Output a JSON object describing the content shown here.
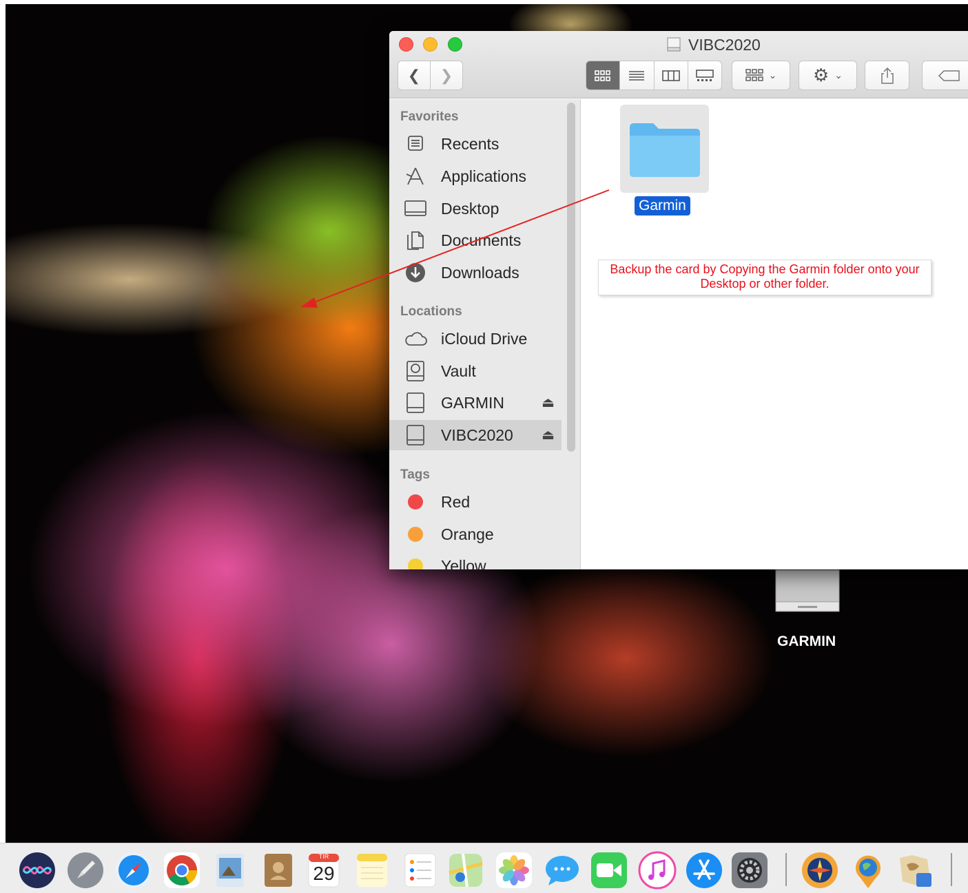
{
  "window": {
    "title": "VIBC2020"
  },
  "sidebar": {
    "favorites_header": "Favorites",
    "favorites": [
      {
        "label": "Recents",
        "icon": "recents-icon"
      },
      {
        "label": "Applications",
        "icon": "applications-icon"
      },
      {
        "label": "Desktop",
        "icon": "desktop-icon"
      },
      {
        "label": "Documents",
        "icon": "documents-icon"
      },
      {
        "label": "Downloads",
        "icon": "downloads-icon"
      }
    ],
    "locations_header": "Locations",
    "locations": [
      {
        "label": "iCloud Drive",
        "icon": "cloud-icon"
      },
      {
        "label": "Vault",
        "icon": "hard-drive-icon"
      },
      {
        "label": "GARMIN",
        "icon": "external-drive-icon",
        "eject": "⏏"
      },
      {
        "label": "VIBC2020",
        "icon": "external-drive-icon",
        "eject": "⏏",
        "selected": true
      }
    ],
    "tags_header": "Tags",
    "tags": [
      {
        "label": "Red",
        "color": "#f04848"
      },
      {
        "label": "Orange",
        "color": "#f7a03a"
      },
      {
        "label": "Yellow",
        "color": "#f6cf36"
      }
    ]
  },
  "content": {
    "folder_name": "Garmin",
    "annotation": "Backup the card by Copying the Garmin folder onto your Desktop or other folder."
  },
  "desktop": {
    "drive_label": "GARMIN"
  },
  "dock": {
    "calendar_month": "TIR",
    "calendar_day": "29",
    "apps": [
      "siri",
      "launchpad",
      "safari",
      "chrome",
      "preview",
      "contacts",
      "calendar",
      "notes",
      "reminders",
      "maps",
      "photos",
      "messages",
      "facetime",
      "itunes",
      "app-store",
      "system-preferences",
      "basecamp",
      "garmin-express",
      "map-manager"
    ]
  }
}
